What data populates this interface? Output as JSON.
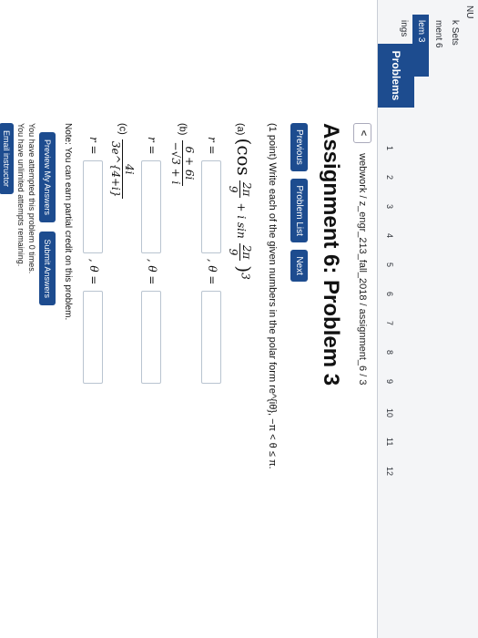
{
  "sidebar": {
    "menu_heading": "NU",
    "items": [
      "k Sets",
      "ment 6",
      "lem 3",
      "ings"
    ],
    "problems_heading": "Problems",
    "problem_numbers": [
      "1",
      "2",
      "3",
      "4",
      "5",
      "6",
      "7",
      "8",
      "9",
      "10",
      "11",
      "12"
    ]
  },
  "header": {
    "back_label": "<",
    "breadcrumb": "webwork / z_engr_213_fall_2018 / assignment_6 / 3",
    "title": "Assignment 6: Problem 3"
  },
  "nav": {
    "previous_label": "Previous",
    "problem_list_label": "Problem List",
    "next_label": "Next"
  },
  "problem": {
    "statement": "(1 point) Write each of the given numbers in the polar form re^{iθ}, −π < θ ≤ π.",
    "part_a": {
      "label": "(a)",
      "expr_open": "(cos",
      "frac1_num": "2π",
      "frac1_den": "9",
      "mid": "+ i sin",
      "frac2_num": "2π",
      "frac2_den": "9",
      "expr_close": ")",
      "exponent": "3",
      "r_label": "r =",
      "theta_label": ", θ ="
    },
    "part_b": {
      "label": "(b)",
      "num": "6 + 6i",
      "den": "−√3 + i",
      "r_label": "r =",
      "theta_label": ", θ ="
    },
    "part_c": {
      "label": "(c)",
      "num": "4i",
      "den": "3e^{4+i}",
      "r_label": "r =",
      "theta_label": ", θ ="
    }
  },
  "note": "Note: You can earn partial credit on this problem.",
  "actions": {
    "preview_label": "Preview My Answers",
    "submit_label": "Submit Answers"
  },
  "attempts": {
    "line1": "You have attempted this problem 0 times.",
    "line2": "You have unlimited attempts remaining."
  },
  "email_label": "Email instructor",
  "colors": {
    "accent": "#1d4c8f"
  }
}
